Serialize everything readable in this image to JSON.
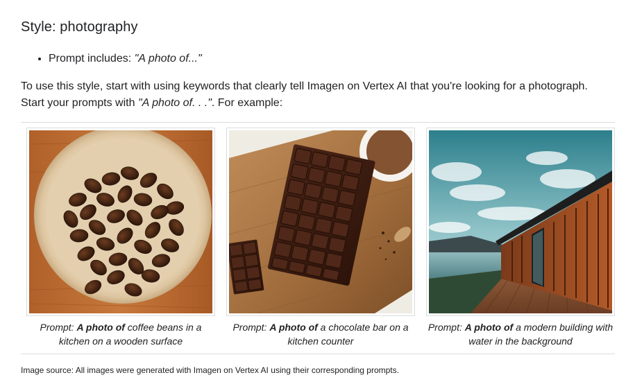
{
  "heading": "Style: photography",
  "bullet": {
    "label": "Prompt includes: ",
    "example": "\"A photo of...\""
  },
  "intro": {
    "line1": "To use this style, start with using keywords that clearly tell Imagen on Vertex AI that you're looking for a photograph.",
    "line2_prefix": "Start your prompts with ",
    "line2_example": "\"A photo of. . .\"",
    "line2_suffix": ". For example:"
  },
  "figures": [
    {
      "image_icon": "coffee-beans-photo",
      "caption_prefix": "Prompt: ",
      "caption_bold": "A photo of",
      "caption_rest": " coffee beans in a kitchen on a wooden surface"
    },
    {
      "image_icon": "chocolate-bar-photo",
      "caption_prefix": "Prompt: ",
      "caption_bold": "A photo of",
      "caption_rest": " a chocolate bar on a kitchen counter"
    },
    {
      "image_icon": "modern-building-photo",
      "caption_prefix": "Prompt: ",
      "caption_bold": "A photo of",
      "caption_rest": " a modern building with water in the background"
    }
  ],
  "image_source": "Image source: All images were generated with Imagen on Vertex AI using their corresponding prompts."
}
